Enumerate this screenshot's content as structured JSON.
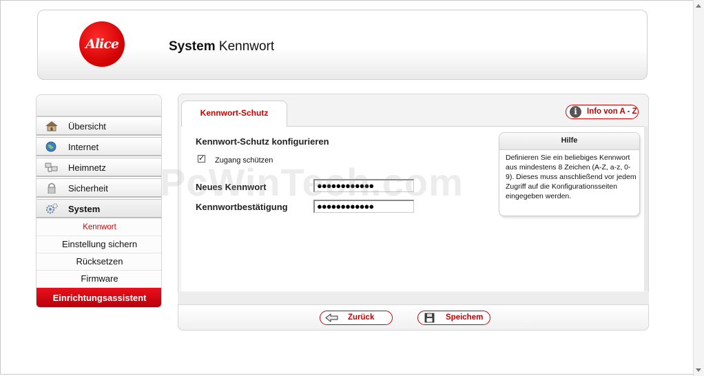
{
  "header": {
    "logo_text": "Alice",
    "title_bold": "System",
    "title_rest": "Kennwort"
  },
  "sidebar": {
    "items": [
      {
        "label": "Übersicht",
        "icon": "house-icon"
      },
      {
        "label": "Internet",
        "icon": "globe-icon"
      },
      {
        "label": "Heimnetz",
        "icon": "network-icon"
      },
      {
        "label": "Sicherheit",
        "icon": "padlock-icon"
      },
      {
        "label": "System",
        "icon": "gear-icon"
      }
    ],
    "subitems": [
      {
        "label": "Kennwort"
      },
      {
        "label": "Einstellung sichern"
      },
      {
        "label": "Rücksetzen"
      },
      {
        "label": "Firmware"
      }
    ],
    "wizard_label": "Einrichtungsassistent"
  },
  "main": {
    "tab_label": "Kennwort-Schutz",
    "info_button": "Info von A - Z",
    "form_title": "Kennwort-Schutz konfigurieren",
    "checkbox_label": "Zugang schützen",
    "checkbox_checked": true,
    "new_password_label": "Neues Kennwort",
    "new_password_value": "●●●●●●●●●●●●",
    "confirm_password_label": "Kennwortbestätigung",
    "confirm_password_value": "●●●●●●●●●●●●"
  },
  "help": {
    "title": "Hilfe",
    "text": "Definieren Sie ein beliebiges Kennwort aus mindestens 8 Zeichen (A-Z, a-z, 0-9). Dieses muss anschließend vor jedem Zugriff auf die Konfigurationsseiten eingegeben werden."
  },
  "footer": {
    "back_label": "Zurück",
    "save_label": "Speichem"
  },
  "watermark": "PcWinTech.com",
  "colors": {
    "accent": "#cc0000",
    "wizard_red": "#d4000f",
    "panel_bg": "#f3f3f3"
  }
}
